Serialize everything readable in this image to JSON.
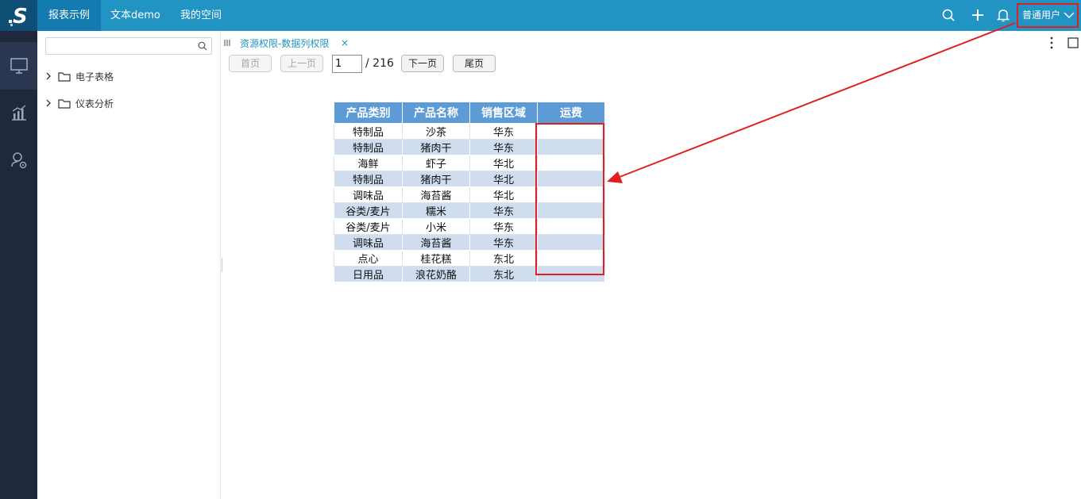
{
  "topbar": {
    "logo": "S",
    "tabs": [
      {
        "label": "报表示例",
        "active": true
      },
      {
        "label": "文本demo",
        "active": false
      },
      {
        "label": "我的空间",
        "active": false
      }
    ],
    "icons": [
      "search-icon",
      "plus-icon",
      "bell-icon"
    ],
    "user": "普通用户",
    "accent": "#2194c3"
  },
  "rail": {
    "items": [
      "monitor-icon",
      "chart-analysis-icon",
      "user-settings-icon"
    ]
  },
  "tree": {
    "search_value": "",
    "nodes": [
      {
        "label": "电子表格"
      },
      {
        "label": "仪表分析"
      }
    ]
  },
  "tab": {
    "title": "资源权限-数据列权限",
    "close": "×"
  },
  "pager": {
    "first": "首页",
    "prev": "上一页",
    "current": "1",
    "total": "/ 216",
    "next": "下一页",
    "last": "尾页"
  },
  "report": {
    "headers": [
      "产品类别",
      "产品名称",
      "销售区域",
      "运费"
    ],
    "rows": [
      [
        "特制品",
        "沙茶",
        "华东",
        ""
      ],
      [
        "特制品",
        "猪肉干",
        "华东",
        ""
      ],
      [
        "海鲜",
        "虾子",
        "华北",
        ""
      ],
      [
        "特制品",
        "猪肉干",
        "华北",
        ""
      ],
      [
        "调味品",
        "海苔酱",
        "华北",
        ""
      ],
      [
        "谷类/麦片",
        "糯米",
        "华东",
        ""
      ],
      [
        "谷类/麦片",
        "小米",
        "华东",
        ""
      ],
      [
        "调味品",
        "海苔酱",
        "华东",
        ""
      ],
      [
        "点心",
        "桂花糕",
        "东北",
        ""
      ],
      [
        "日用品",
        "浪花奶酪",
        "东北",
        ""
      ]
    ],
    "header_color": "#5c9bd6",
    "stripe_color": "#cfddee"
  },
  "annotation": {
    "color": "#e02020"
  }
}
